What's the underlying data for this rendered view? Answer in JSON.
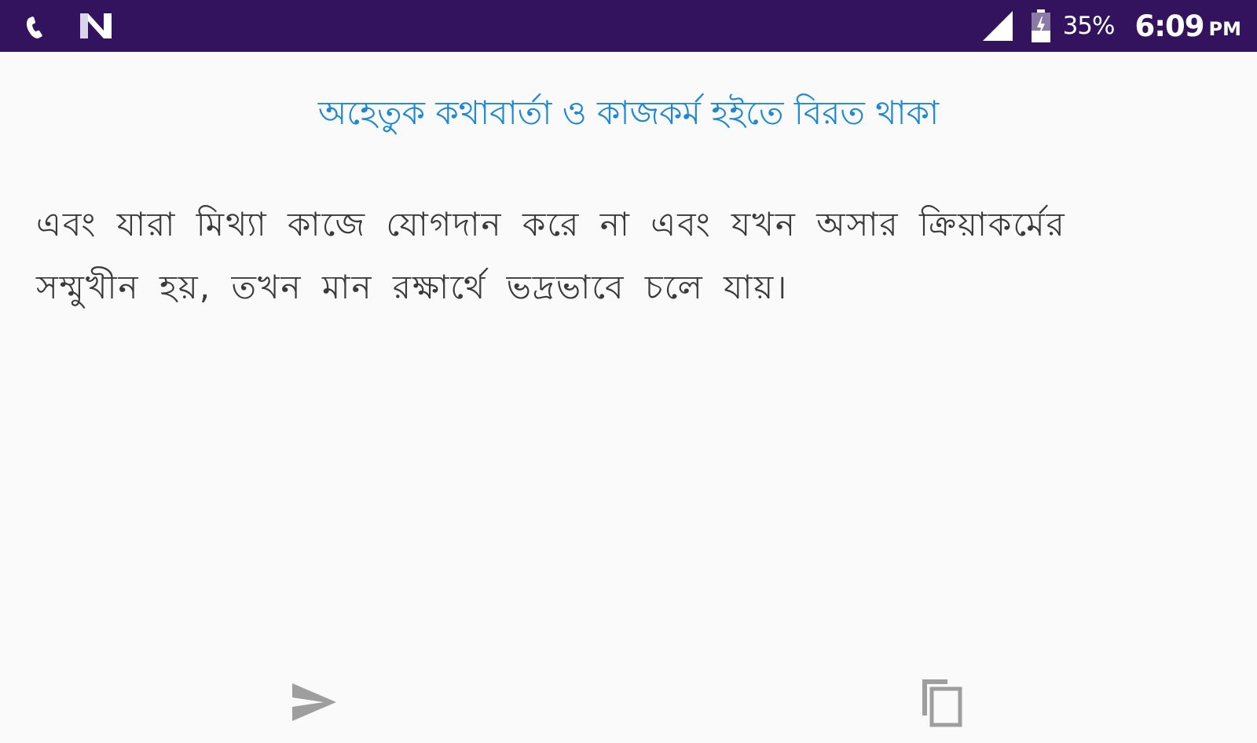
{
  "status_bar": {
    "left_icons": [
      "phone-icon",
      "notification-n-icon"
    ],
    "right_icons": [
      "signal-icon",
      "battery-icon"
    ],
    "battery": "35%",
    "time": "6:09",
    "ampm": "PM",
    "background": "#33135e"
  },
  "main": {
    "title": "অহেতুক কথাবার্তা ও কাজকর্ম হইতে বিরত থাকা",
    "body": "এবং যারা মিথ্যা কাজে যোগদান করে না এবং যখন অসার ক্রিয়াকর্মের সম্মুখীন হয়, তখন মান রক্ষার্থে ভদ্রভাবে চলে যায়।",
    "title_color": "#1e88d2",
    "body_color": "#3a3a3a"
  },
  "actions": {
    "share_icon": "send-icon",
    "copy_icon": "copy-icon"
  }
}
